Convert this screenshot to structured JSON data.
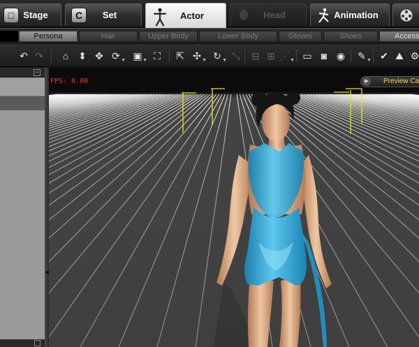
{
  "main_tabs": [
    {
      "label": "Stage",
      "icon": "stage-icon",
      "state": "normal"
    },
    {
      "label": "Set",
      "icon": "set-icon",
      "state": "normal"
    },
    {
      "label": "Actor",
      "icon": "actor-icon",
      "state": "active"
    },
    {
      "label": "Head",
      "icon": "head-icon",
      "state": "disabled"
    },
    {
      "label": "Animation",
      "icon": "animation-icon",
      "state": "normal"
    },
    {
      "label": "",
      "icon": "film-reel-icon",
      "state": "normal"
    }
  ],
  "sub_tabs": [
    {
      "label": "",
      "state": "black"
    },
    {
      "label": "Persona",
      "state": "active"
    },
    {
      "label": "Hair",
      "state": "disabled"
    },
    {
      "label": "Upper Body",
      "state": "disabled"
    },
    {
      "label": "Lower Body",
      "state": "disabled"
    },
    {
      "label": "Gloves",
      "state": "disabled"
    },
    {
      "label": "Shoes",
      "state": "disabled"
    },
    {
      "label": "Access",
      "state": "enabled"
    }
  ],
  "toolbar": {
    "tools": [
      {
        "name": "undo-icon",
        "glyph": "↶",
        "dim": false,
        "dropdown": false
      },
      {
        "name": "redo-icon",
        "glyph": "↷",
        "dim": true,
        "dropdown": false
      },
      {
        "name": "home-icon",
        "glyph": "⌂",
        "dim": false,
        "dropdown": false
      },
      {
        "name": "drop-to-floor-icon",
        "glyph": "⬍",
        "dim": false,
        "dropdown": false
      },
      {
        "name": "move-icon",
        "glyph": "✥",
        "dim": false,
        "dropdown": false
      },
      {
        "name": "rotate-icon",
        "glyph": "⟳",
        "dim": false,
        "dropdown": true
      },
      {
        "name": "box-view-icon",
        "glyph": "▣",
        "dim": false,
        "dropdown": true
      },
      {
        "name": "frame-icon",
        "glyph": "⛶",
        "dim": false,
        "dropdown": false
      },
      {
        "name": "select-icon",
        "glyph": "⇱",
        "dim": false,
        "dropdown": false
      },
      {
        "name": "transform-icon",
        "glyph": "✣",
        "dim": false,
        "dropdown": true
      },
      {
        "name": "rotate-camera-icon",
        "glyph": "↻",
        "dim": false,
        "dropdown": true
      },
      {
        "name": "scale-icon",
        "glyph": "⤡",
        "dim": true,
        "dropdown": false
      },
      {
        "name": "align-icon",
        "glyph": "⊟",
        "dim": true,
        "dropdown": false
      },
      {
        "name": "distribute-icon",
        "glyph": "⊞",
        "dim": true,
        "dropdown": false
      },
      {
        "name": "snap-icon",
        "glyph": "⋰",
        "dim": true,
        "dropdown": true
      },
      {
        "name": "window-icon",
        "glyph": "▭",
        "dim": false,
        "dropdown": false
      },
      {
        "name": "preview-icon",
        "glyph": "◙",
        "dim": false,
        "dropdown": false
      },
      {
        "name": "fit-view-icon",
        "glyph": "◉",
        "dim": false,
        "dropdown": false
      },
      {
        "name": "brush-icon",
        "glyph": "✎",
        "dim": false,
        "dropdown": true
      },
      {
        "name": "check-icon",
        "glyph": "✔",
        "dim": false,
        "dropdown": false
      },
      {
        "name": "terrain-icon",
        "glyph": "⛰",
        "dim": false,
        "dropdown": false
      },
      {
        "name": "settings-icon",
        "glyph": "⚙",
        "dim": false,
        "dropdown": false
      }
    ]
  },
  "viewport": {
    "fps_text": "FPS: 0.00",
    "preview_camera_label": "Preview Ca"
  },
  "colors": {
    "fps_red": "#ff3030",
    "camera_label": "#ffd34a",
    "dress_blue": "#2aa6d4",
    "grid_line": "#dedede"
  }
}
